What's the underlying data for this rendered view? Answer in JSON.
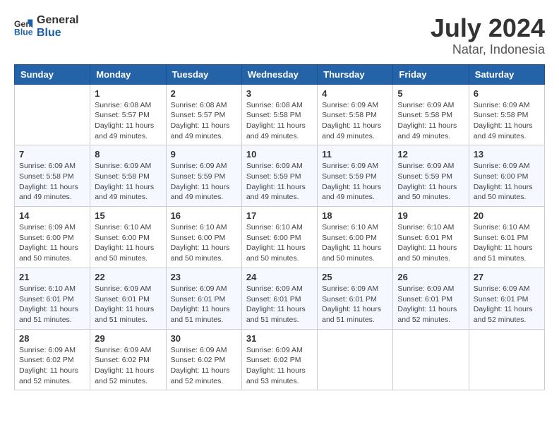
{
  "header": {
    "logo_line1": "General",
    "logo_line2": "Blue",
    "title": "July 2024",
    "subtitle": "Natar, Indonesia"
  },
  "calendar": {
    "days_of_week": [
      "Sunday",
      "Monday",
      "Tuesday",
      "Wednesday",
      "Thursday",
      "Friday",
      "Saturday"
    ],
    "weeks": [
      [
        {
          "day": "",
          "info": ""
        },
        {
          "day": "1",
          "info": "Sunrise: 6:08 AM\nSunset: 5:57 PM\nDaylight: 11 hours\nand 49 minutes."
        },
        {
          "day": "2",
          "info": "Sunrise: 6:08 AM\nSunset: 5:57 PM\nDaylight: 11 hours\nand 49 minutes."
        },
        {
          "day": "3",
          "info": "Sunrise: 6:08 AM\nSunset: 5:58 PM\nDaylight: 11 hours\nand 49 minutes."
        },
        {
          "day": "4",
          "info": "Sunrise: 6:09 AM\nSunset: 5:58 PM\nDaylight: 11 hours\nand 49 minutes."
        },
        {
          "day": "5",
          "info": "Sunrise: 6:09 AM\nSunset: 5:58 PM\nDaylight: 11 hours\nand 49 minutes."
        },
        {
          "day": "6",
          "info": "Sunrise: 6:09 AM\nSunset: 5:58 PM\nDaylight: 11 hours\nand 49 minutes."
        }
      ],
      [
        {
          "day": "7",
          "info": "Sunrise: 6:09 AM\nSunset: 5:58 PM\nDaylight: 11 hours\nand 49 minutes."
        },
        {
          "day": "8",
          "info": "Sunrise: 6:09 AM\nSunset: 5:58 PM\nDaylight: 11 hours\nand 49 minutes."
        },
        {
          "day": "9",
          "info": "Sunrise: 6:09 AM\nSunset: 5:59 PM\nDaylight: 11 hours\nand 49 minutes."
        },
        {
          "day": "10",
          "info": "Sunrise: 6:09 AM\nSunset: 5:59 PM\nDaylight: 11 hours\nand 49 minutes."
        },
        {
          "day": "11",
          "info": "Sunrise: 6:09 AM\nSunset: 5:59 PM\nDaylight: 11 hours\nand 49 minutes."
        },
        {
          "day": "12",
          "info": "Sunrise: 6:09 AM\nSunset: 5:59 PM\nDaylight: 11 hours\nand 50 minutes."
        },
        {
          "day": "13",
          "info": "Sunrise: 6:09 AM\nSunset: 6:00 PM\nDaylight: 11 hours\nand 50 minutes."
        }
      ],
      [
        {
          "day": "14",
          "info": "Sunrise: 6:09 AM\nSunset: 6:00 PM\nDaylight: 11 hours\nand 50 minutes."
        },
        {
          "day": "15",
          "info": "Sunrise: 6:10 AM\nSunset: 6:00 PM\nDaylight: 11 hours\nand 50 minutes."
        },
        {
          "day": "16",
          "info": "Sunrise: 6:10 AM\nSunset: 6:00 PM\nDaylight: 11 hours\nand 50 minutes."
        },
        {
          "day": "17",
          "info": "Sunrise: 6:10 AM\nSunset: 6:00 PM\nDaylight: 11 hours\nand 50 minutes."
        },
        {
          "day": "18",
          "info": "Sunrise: 6:10 AM\nSunset: 6:00 PM\nDaylight: 11 hours\nand 50 minutes."
        },
        {
          "day": "19",
          "info": "Sunrise: 6:10 AM\nSunset: 6:01 PM\nDaylight: 11 hours\nand 50 minutes."
        },
        {
          "day": "20",
          "info": "Sunrise: 6:10 AM\nSunset: 6:01 PM\nDaylight: 11 hours\nand 51 minutes."
        }
      ],
      [
        {
          "day": "21",
          "info": "Sunrise: 6:10 AM\nSunset: 6:01 PM\nDaylight: 11 hours\nand 51 minutes."
        },
        {
          "day": "22",
          "info": "Sunrise: 6:09 AM\nSunset: 6:01 PM\nDaylight: 11 hours\nand 51 minutes."
        },
        {
          "day": "23",
          "info": "Sunrise: 6:09 AM\nSunset: 6:01 PM\nDaylight: 11 hours\nand 51 minutes."
        },
        {
          "day": "24",
          "info": "Sunrise: 6:09 AM\nSunset: 6:01 PM\nDaylight: 11 hours\nand 51 minutes."
        },
        {
          "day": "25",
          "info": "Sunrise: 6:09 AM\nSunset: 6:01 PM\nDaylight: 11 hours\nand 51 minutes."
        },
        {
          "day": "26",
          "info": "Sunrise: 6:09 AM\nSunset: 6:01 PM\nDaylight: 11 hours\nand 52 minutes."
        },
        {
          "day": "27",
          "info": "Sunrise: 6:09 AM\nSunset: 6:01 PM\nDaylight: 11 hours\nand 52 minutes."
        }
      ],
      [
        {
          "day": "28",
          "info": "Sunrise: 6:09 AM\nSunset: 6:02 PM\nDaylight: 11 hours\nand 52 minutes."
        },
        {
          "day": "29",
          "info": "Sunrise: 6:09 AM\nSunset: 6:02 PM\nDaylight: 11 hours\nand 52 minutes."
        },
        {
          "day": "30",
          "info": "Sunrise: 6:09 AM\nSunset: 6:02 PM\nDaylight: 11 hours\nand 52 minutes."
        },
        {
          "day": "31",
          "info": "Sunrise: 6:09 AM\nSunset: 6:02 PM\nDaylight: 11 hours\nand 53 minutes."
        },
        {
          "day": "",
          "info": ""
        },
        {
          "day": "",
          "info": ""
        },
        {
          "day": "",
          "info": ""
        }
      ]
    ]
  }
}
